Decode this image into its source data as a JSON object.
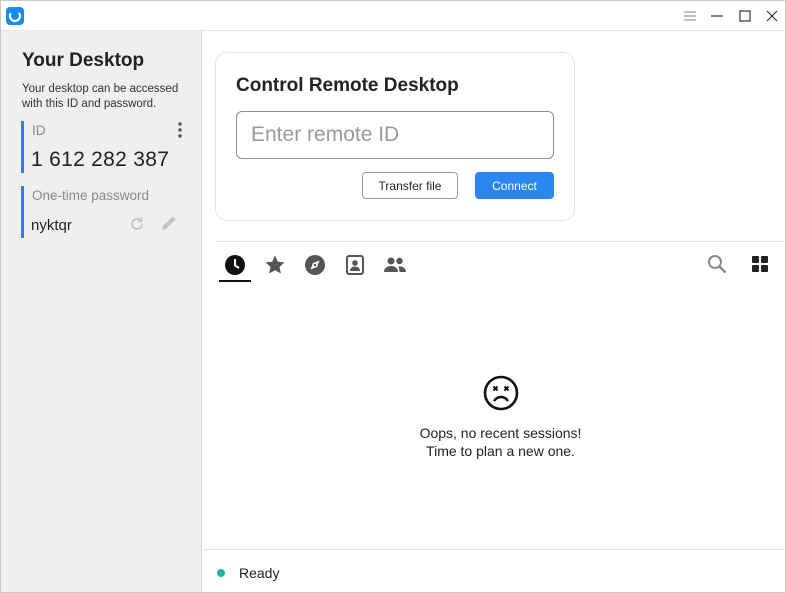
{
  "colors": {
    "accent": "#2b87f0",
    "sidebar_bg": "#efefef",
    "field_marker": "#2d7fe8",
    "status_ready": "#20b2a0"
  },
  "titlebar": {
    "icons": [
      "app-logo-icon",
      "menu-icon",
      "minimize-icon",
      "maximize-icon",
      "close-icon"
    ]
  },
  "sidebar": {
    "title": "Your Desktop",
    "description": "Your desktop can be accessed with this ID and password.",
    "id_label": "ID",
    "id_value": "1 612 282 387",
    "password_label": "One-time password",
    "password_value": "nyktqr"
  },
  "connect_card": {
    "title": "Control Remote Desktop",
    "input_placeholder": "Enter remote ID",
    "input_value": "",
    "transfer_label": "Transfer file",
    "connect_label": "Connect"
  },
  "tabs": [
    {
      "icon": "history-icon",
      "selected": true
    },
    {
      "icon": "star-icon",
      "selected": false
    },
    {
      "icon": "compass-icon",
      "selected": false
    },
    {
      "icon": "address-book-icon",
      "selected": false
    },
    {
      "icon": "group-icon",
      "selected": false
    }
  ],
  "toolbar_icons": [
    "search-icon",
    "grid-view-icon"
  ],
  "empty_state": {
    "line1": "Oops, no recent sessions!",
    "line2": "Time to plan a new one."
  },
  "status": {
    "text": "Ready"
  }
}
